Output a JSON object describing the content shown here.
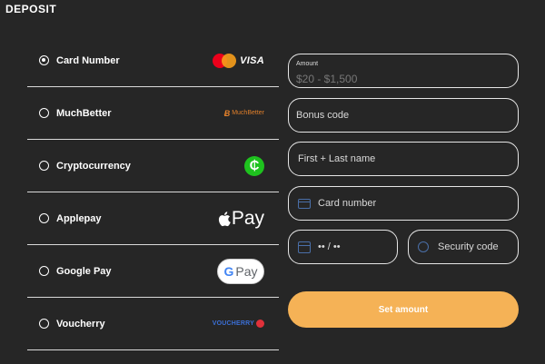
{
  "header": {
    "title": "DEPOSIT"
  },
  "methods": [
    {
      "label": "Card Number",
      "selected": true,
      "logo": "mastercard-visa-logo",
      "logo_text": "VISA"
    },
    {
      "label": "MuchBetter",
      "selected": false,
      "logo": "muchbetter-logo",
      "logo_text": "MuchBetter"
    },
    {
      "label": "Cryptocurrency",
      "selected": false,
      "logo": "cryptocurrency-logo",
      "logo_text": "₵"
    },
    {
      "label": "Applepay",
      "selected": false,
      "logo": "apple-pay-logo",
      "logo_text": "Pay"
    },
    {
      "label": "Google Pay",
      "selected": false,
      "logo": "google-pay-logo",
      "logo_text": "Pay"
    },
    {
      "label": "Voucherry",
      "selected": false,
      "logo": "voucherry-logo",
      "logo_text": "VOUCHERRY"
    }
  ],
  "form": {
    "amount_label": "Amount",
    "amount_placeholder": "$20 - $1,500",
    "bonus_placeholder": "Bonus code",
    "name_placeholder": "First + Last name",
    "card_placeholder": "Card number",
    "expiry_placeholder": "•• / ••",
    "cvc_placeholder": "Security code",
    "submit_label": "Set amount"
  },
  "colors": {
    "background": "#262626",
    "accent": "#f5b256",
    "divider": "#d9d9d9"
  }
}
